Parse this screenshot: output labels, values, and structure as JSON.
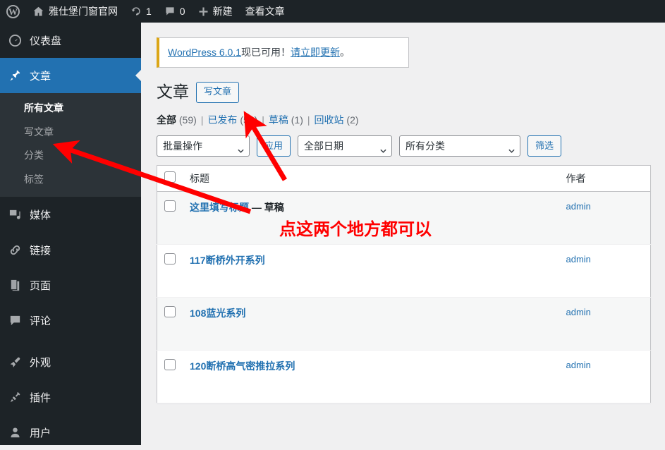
{
  "adminbar": {
    "logo_icon": "wordpress-logo-icon",
    "site_icon": "home-icon",
    "site_name": "雅仕堡门窗官网",
    "updates_icon": "updates-icon",
    "updates_count": "1",
    "comments_icon": "comment-bubble-icon",
    "comments_count": "0",
    "new_icon": "plus-icon",
    "new_label": "新建",
    "view_posts_label": "查看文章"
  },
  "sidebar": {
    "items": [
      {
        "label": "仪表盘",
        "icon": "dashboard-icon",
        "current": false
      },
      {
        "label": "文章",
        "icon": "pin-icon",
        "current": true
      },
      {
        "label": "媒体",
        "icon": "media-icon",
        "current": false
      },
      {
        "label": "链接",
        "icon": "link-icon",
        "current": false
      },
      {
        "label": "页面",
        "icon": "page-icon",
        "current": false
      },
      {
        "label": "评论",
        "icon": "comment-icon",
        "current": false
      },
      {
        "label": "外观",
        "icon": "appearance-brush-icon",
        "current": false
      },
      {
        "label": "插件",
        "icon": "plugin-plug-icon",
        "current": false
      },
      {
        "label": "用户",
        "icon": "user-icon",
        "current": false
      }
    ],
    "submenu": [
      {
        "label": "所有文章",
        "current": true
      },
      {
        "label": "写文章",
        "current": false
      },
      {
        "label": "分类",
        "current": false
      },
      {
        "label": "标签",
        "current": false
      }
    ]
  },
  "notice": {
    "link_version": "WordPress 6.0.1",
    "text_middle": "现已可用！",
    "link_update": "请立即更新",
    "text_end": "。"
  },
  "page": {
    "title": "文章",
    "add_new_label": "写文章"
  },
  "status_links": [
    {
      "label": "全部",
      "count": "(59)",
      "current": true
    },
    {
      "label": "已发布",
      "count": "(58)",
      "current": false
    },
    {
      "label": "草稿",
      "count": "(1)",
      "current": false
    },
    {
      "label": "回收站",
      "count": "(2)",
      "current": false
    }
  ],
  "tablenav": {
    "bulk_action_value": "批量操作",
    "apply_label": "应用",
    "date_filter_value": "全部日期",
    "category_filter_value": "所有分类",
    "filter_label": "筛选",
    "chevron_icon": "chevron-down-icon"
  },
  "table": {
    "columns": {
      "checkbox": "select-all-checkbox",
      "title": "标题",
      "author": "作者"
    },
    "rows": [
      {
        "title": "这里填写标题",
        "state": "— 草稿",
        "author": "admin"
      },
      {
        "title": "117断桥外开系列",
        "state": "",
        "author": "admin"
      },
      {
        "title": "108蓝光系列",
        "state": "",
        "author": "admin"
      },
      {
        "title": "120断桥高气密推拉系列",
        "state": "",
        "author": "admin"
      }
    ]
  },
  "annotations": {
    "note_text": "点这两个地方都可以",
    "color": "#ff0000"
  },
  "colors": {
    "admin_blue": "#2271b1",
    "sidebar_bg": "#1d2327",
    "submenu_bg": "#2c3338",
    "notice_accent": "#dba617",
    "annotation_red": "#ff0000"
  }
}
